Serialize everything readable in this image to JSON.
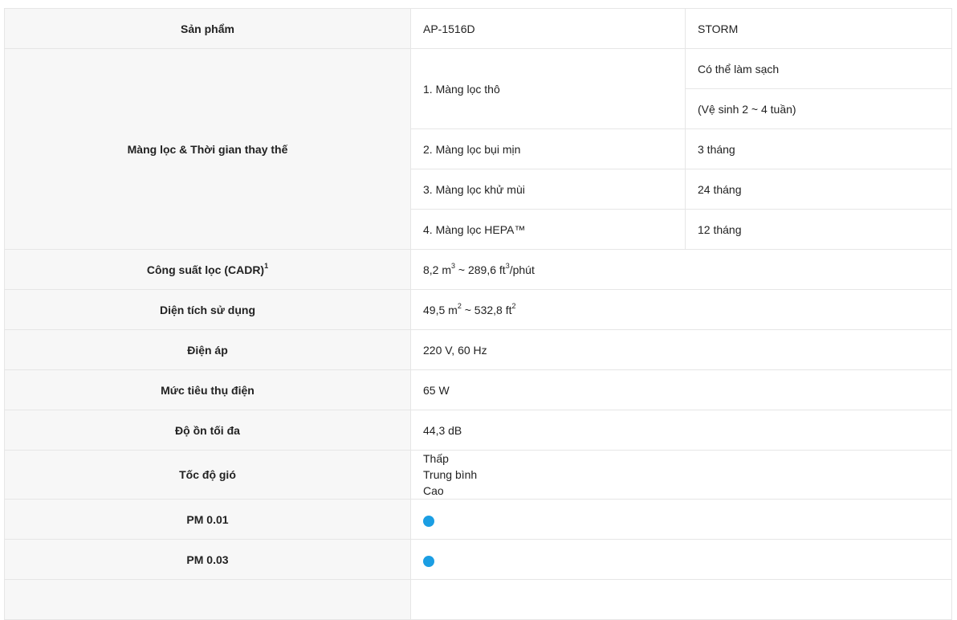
{
  "header": {
    "label": "Sản phẩm",
    "model": "AP-1516D",
    "name": "STORM"
  },
  "filters": {
    "label": "Màng lọc & Thời gian thay thế",
    "items": [
      {
        "name": "1. Màng lọc thô",
        "times": [
          "Có thể làm sạch",
          "(Vệ sinh 2 ~ 4 tuần)"
        ]
      },
      {
        "name": "2. Màng lọc bụi mịn",
        "time": "3 tháng"
      },
      {
        "name": "3. Màng lọc khử mùi",
        "time": "24 tháng"
      },
      {
        "name": "4. Màng lọc HEPA™",
        "time": "12 tháng"
      }
    ]
  },
  "cadr": {
    "label": "Công suất lọc (CADR)",
    "label_sup": "1",
    "value_a": "8,2 m",
    "value_a_sup": "3",
    "value_b": " ~ 289,6 ft",
    "value_b_sup": "3",
    "value_c": "/phút"
  },
  "area": {
    "label": "Diện tích sử dụng",
    "value_a": "49,5 m",
    "value_a_sup": "2",
    "value_b": " ~ 532,8 ft",
    "value_b_sup": "2"
  },
  "voltage": {
    "label": "Điện áp",
    "value": "220 V, 60 Hz"
  },
  "power": {
    "label": "Mức tiêu thụ điện",
    "value": "65 W"
  },
  "noise": {
    "label": "Độ ồn tối đa",
    "value": "44,3 dB"
  },
  "fan": {
    "label": "Tốc độ gió",
    "speeds": [
      "Thấp",
      "Trung bình",
      "Cao"
    ]
  },
  "pm001": {
    "label": "PM 0.01",
    "dot_color": "#1b9ee3"
  },
  "pm003": {
    "label": "PM 0.03",
    "dot_color": "#1b9ee3"
  }
}
